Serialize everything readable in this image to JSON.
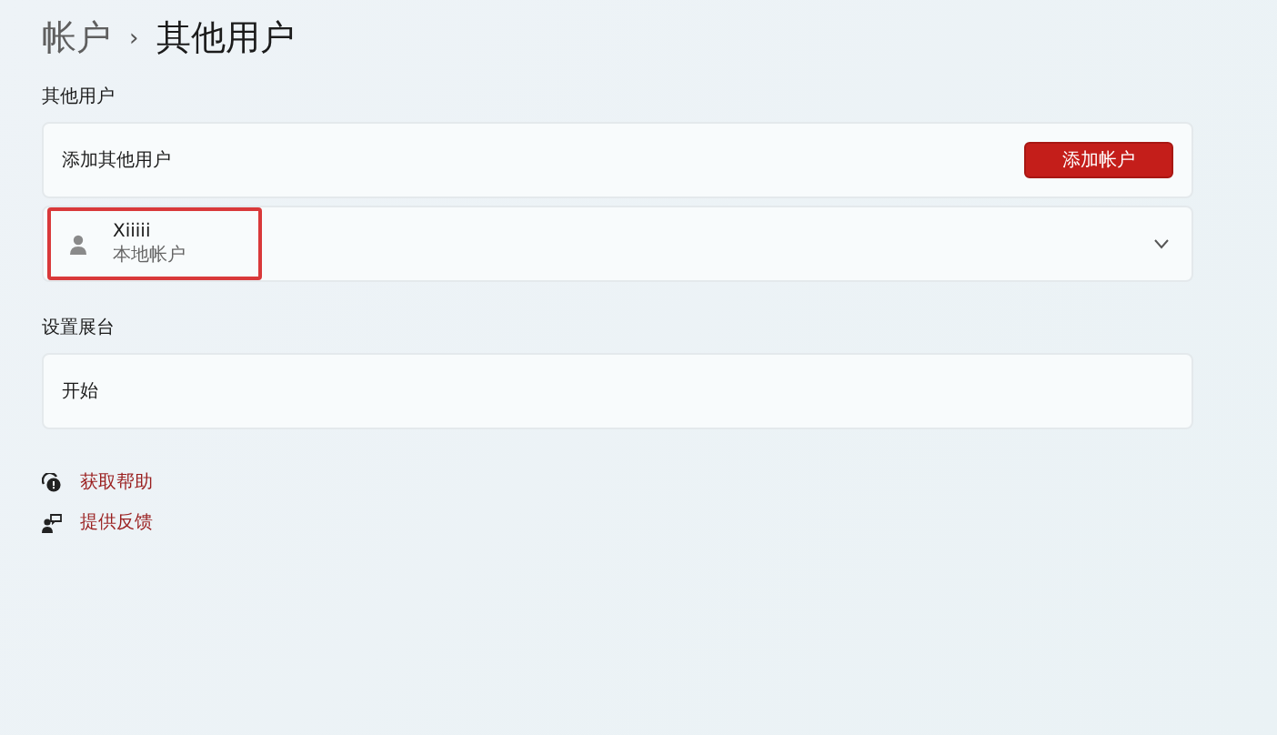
{
  "breadcrumb": {
    "parent": "帐户",
    "separator": "›",
    "current": "其他用户"
  },
  "sections": [
    {
      "title": "其他用户",
      "cards": [
        {
          "kind": "action",
          "label": "添加其他用户",
          "button": "添加帐户"
        },
        {
          "kind": "user",
          "name": "Xiiiii",
          "subtitle": "本地帐户",
          "highlighted": true,
          "expanded": false
        }
      ]
    },
    {
      "title": "设置展台",
      "cards": [
        {
          "kind": "plain",
          "label": "开始"
        }
      ]
    }
  ],
  "links": [
    {
      "kind": "help",
      "label": "获取帮助"
    },
    {
      "kind": "feedback",
      "label": "提供反馈"
    }
  ]
}
